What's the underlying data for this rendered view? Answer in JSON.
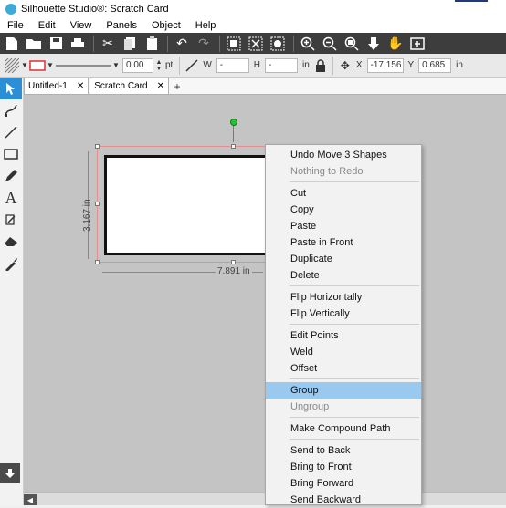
{
  "window": {
    "title": "Silhouette Studio®: Scratch Card"
  },
  "menubar": {
    "items": [
      "File",
      "Edit",
      "View",
      "Panels",
      "Object",
      "Help"
    ]
  },
  "toolbar2": {
    "line_width_value": "0.00",
    "line_width_unit": "pt",
    "w_label": "W",
    "w_value": "-",
    "h_label": "H",
    "h_value": "-",
    "in_label_1": "in",
    "x_label": "X",
    "x_value": "-17.156",
    "y_label": "Y",
    "y_value": "0.685",
    "in_label_2": "in"
  },
  "tabs": [
    {
      "label": "Untitled-1"
    },
    {
      "label": "Scratch Card"
    }
  ],
  "canvas": {
    "height_dimension": "3.167 in",
    "width_dimension": "7.891 in"
  },
  "context_menu": {
    "groups": [
      [
        {
          "label": "Undo Move 3 Shapes",
          "disabled": false
        },
        {
          "label": "Nothing to Redo",
          "disabled": true
        }
      ],
      [
        {
          "label": "Cut",
          "disabled": false
        },
        {
          "label": "Copy",
          "disabled": false
        },
        {
          "label": "Paste",
          "disabled": false
        },
        {
          "label": "Paste in Front",
          "disabled": false
        },
        {
          "label": "Duplicate",
          "disabled": false
        },
        {
          "label": "Delete",
          "disabled": false
        }
      ],
      [
        {
          "label": "Flip Horizontally",
          "disabled": false
        },
        {
          "label": "Flip Vertically",
          "disabled": false
        }
      ],
      [
        {
          "label": "Edit Points",
          "disabled": false
        },
        {
          "label": "Weld",
          "disabled": false
        },
        {
          "label": "Offset",
          "disabled": false
        }
      ],
      [
        {
          "label": "Group",
          "disabled": false,
          "highlight": true
        },
        {
          "label": "Ungroup",
          "disabled": true
        }
      ],
      [
        {
          "label": "Make Compound Path",
          "disabled": false
        }
      ],
      [
        {
          "label": "Send to Back",
          "disabled": false
        },
        {
          "label": "Bring to Front",
          "disabled": false
        },
        {
          "label": "Bring Forward",
          "disabled": false
        },
        {
          "label": "Send Backward",
          "disabled": false
        }
      ]
    ]
  },
  "colors": {
    "toolbar_bg": "#3d3d3d",
    "active_tool": "#2a8fd6",
    "menu_highlight": "#99c9ef",
    "canvas_bg": "#c4c4c4",
    "rotation_handle": "#22c52a"
  }
}
